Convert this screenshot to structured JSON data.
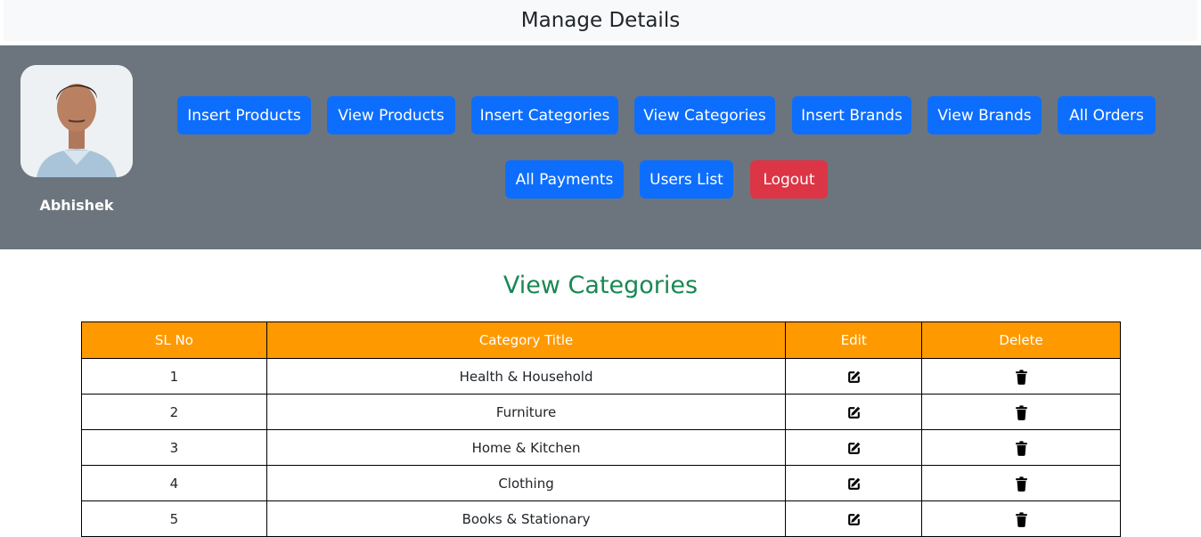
{
  "header": {
    "title": "Manage Details"
  },
  "profile": {
    "name": "Abhishek"
  },
  "nav": {
    "insert_products": "Insert Products",
    "view_products": "View Products",
    "insert_categories": "Insert Categories",
    "view_categories": "View Categories",
    "insert_brands": "Insert Brands",
    "view_brands": "View Brands",
    "all_orders": "All Orders",
    "all_payments": "All Payments",
    "users_list": "Users List",
    "logout": "Logout"
  },
  "section": {
    "title": "View Categories"
  },
  "table": {
    "headers": [
      "SL No",
      "Category Title",
      "Edit",
      "Delete"
    ],
    "rows": [
      {
        "sl": "1",
        "title": "Health & Household",
        "edit_icon": "edit-icon",
        "delete_icon": "trash-icon"
      },
      {
        "sl": "2",
        "title": "Furniture",
        "edit_icon": "edit-icon",
        "delete_icon": "trash-icon"
      },
      {
        "sl": "3",
        "title": "Home & Kitchen",
        "edit_icon": "edit-icon",
        "delete_icon": "trash-icon"
      },
      {
        "sl": "4",
        "title": "Clothing",
        "edit_icon": "edit-icon",
        "delete_icon": "trash-icon"
      },
      {
        "sl": "5",
        "title": "Books & Stationary",
        "edit_icon": "edit-icon",
        "delete_icon": "trash-icon"
      }
    ]
  },
  "colors": {
    "primary": "#0d6efd",
    "danger": "#dc3545",
    "panel": "#6c757d",
    "table_header": "#ff9900",
    "section_title": "#198754"
  }
}
